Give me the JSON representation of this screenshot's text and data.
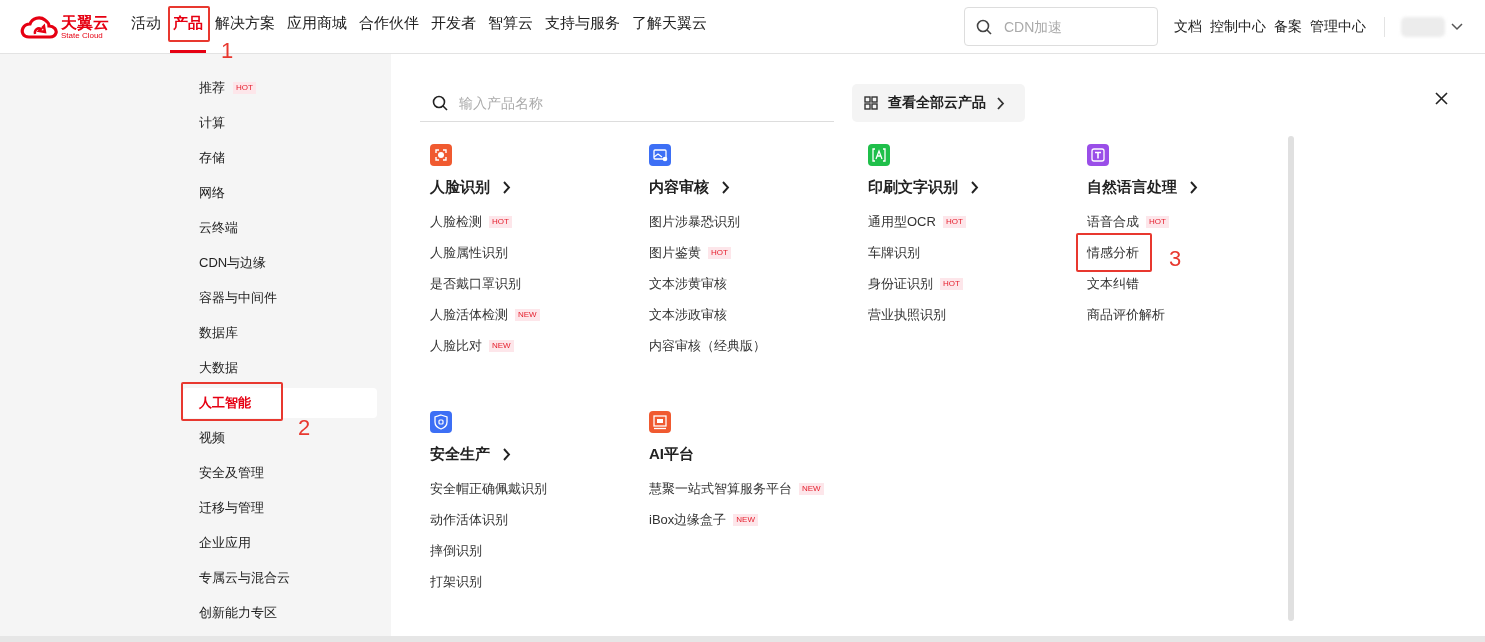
{
  "header": {
    "logo": {
      "name": "天翼云",
      "subtitle": "State Cloud"
    },
    "nav": [
      {
        "label": "活动",
        "selected": false
      },
      {
        "label": "产品",
        "selected": true,
        "callout": "1"
      },
      {
        "label": "解决方案",
        "selected": false
      },
      {
        "label": "应用商城",
        "selected": false
      },
      {
        "label": "合作伙伴",
        "selected": false
      },
      {
        "label": "开发者",
        "selected": false
      },
      {
        "label": "智算云",
        "selected": false
      },
      {
        "label": "支持与服务",
        "selected": false
      },
      {
        "label": "了解天翼云",
        "selected": false
      }
    ],
    "search": {
      "placeholder": "CDN加速"
    },
    "links": [
      "文档",
      "控制中心",
      "备案",
      "管理中心"
    ]
  },
  "sidebar": {
    "items": [
      {
        "label": "推荐",
        "selected": false,
        "badge": "HOT"
      },
      {
        "label": "计算",
        "selected": false
      },
      {
        "label": "存储",
        "selected": false
      },
      {
        "label": "网络",
        "selected": false
      },
      {
        "label": "云终端",
        "selected": false
      },
      {
        "label": "CDN与边缘",
        "selected": false
      },
      {
        "label": "容器与中间件",
        "selected": false
      },
      {
        "label": "数据库",
        "selected": false
      },
      {
        "label": "大数据",
        "selected": false
      },
      {
        "label": "人工智能",
        "selected": true,
        "callout": "2"
      },
      {
        "label": "视频",
        "selected": false
      },
      {
        "label": "安全及管理",
        "selected": false
      },
      {
        "label": "迁移与管理",
        "selected": false
      },
      {
        "label": "企业应用",
        "selected": false
      },
      {
        "label": "专属云与混合云",
        "selected": false
      },
      {
        "label": "创新能力专区",
        "selected": false
      }
    ]
  },
  "panel": {
    "search": {
      "placeholder": "输入产品名称"
    },
    "view_all": "查看全部云产品",
    "groups": [
      {
        "title": "人脸识别",
        "kind": "face",
        "color": "#f05a30",
        "has_arrow": true,
        "items": [
          {
            "label": "人脸检测",
            "badge": "HOT"
          },
          {
            "label": "人脸属性识别"
          },
          {
            "label": "是否戴口罩识别"
          },
          {
            "label": "人脸活体检测",
            "badge": "NEW"
          },
          {
            "label": "人脸比对",
            "badge": "NEW"
          }
        ]
      },
      {
        "title": "内容审核",
        "kind": "image",
        "color": "#3d6ff5",
        "has_arrow": true,
        "items": [
          {
            "label": "图片涉暴恐识别"
          },
          {
            "label": "图片鉴黄",
            "badge": "HOT"
          },
          {
            "label": "文本涉黄审核"
          },
          {
            "label": "文本涉政审核"
          },
          {
            "label": "内容审核（经典版）"
          }
        ]
      },
      {
        "title": "印刷文字识别",
        "kind": "ocr",
        "color": "#1fbf4a",
        "has_arrow": true,
        "items": [
          {
            "label": "通用型OCR",
            "badge": "HOT"
          },
          {
            "label": "车牌识别"
          },
          {
            "label": "身份证识别",
            "badge": "HOT"
          },
          {
            "label": "营业执照识别"
          }
        ]
      },
      {
        "title": "自然语言处理",
        "kind": "nlp",
        "color": "#9a4ee8",
        "has_arrow": true,
        "items": [
          {
            "label": "语音合成",
            "badge": "HOT"
          },
          {
            "label": "情感分析",
            "callout": "3"
          },
          {
            "label": "文本纠错"
          },
          {
            "label": "商品评价解析"
          }
        ]
      },
      {
        "title": "安全生产",
        "kind": "shield",
        "color": "#3d6ff5",
        "has_arrow": true,
        "items": [
          {
            "label": "安全帽正确佩戴识别"
          },
          {
            "label": "动作活体识别"
          },
          {
            "label": "摔倒识别"
          },
          {
            "label": "打架识别"
          }
        ]
      },
      {
        "title": "AI平台",
        "kind": "screen",
        "color": "#f05a30",
        "has_arrow": false,
        "items": [
          {
            "label": "慧聚一站式智算服务平台",
            "badge": "NEW"
          },
          {
            "label": "iBox边缘盒子",
            "badge": "NEW"
          }
        ]
      }
    ]
  }
}
